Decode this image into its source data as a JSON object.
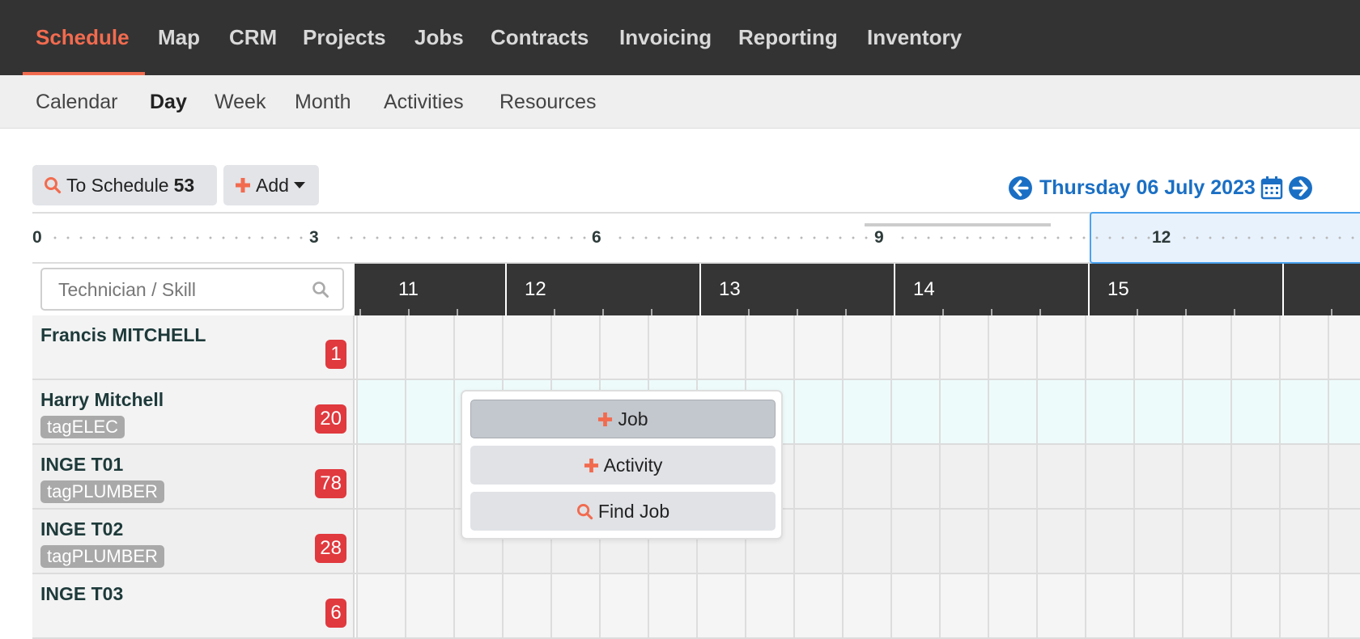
{
  "top_nav": {
    "items": [
      "Schedule",
      "Map",
      "CRM",
      "Projects",
      "Jobs",
      "Contracts",
      "Invoicing",
      "Reporting",
      "Inventory"
    ],
    "active": "Schedule",
    "accent_color": "#f26b4f"
  },
  "sub_nav": {
    "items": [
      "Calendar",
      "Day",
      "Week",
      "Month",
      "Activities",
      "Resources"
    ],
    "active": "Day"
  },
  "toolbar": {
    "to_schedule_label": "To Schedule",
    "to_schedule_count": "53",
    "add_label": "Add",
    "date": "Thursday 06 July 2023",
    "icons": [
      "search-icon",
      "plus-icon",
      "caret-down-icon",
      "arrow-left-circle-icon",
      "calendar-icon",
      "arrow-right-circle-icon"
    ]
  },
  "overview_ruler": {
    "ticks": [
      "0",
      "3",
      "6",
      "9",
      "12"
    ]
  },
  "resource_search": {
    "placeholder": "Technician / Skill"
  },
  "timeline": {
    "hours": [
      "11",
      "12",
      "13",
      "14",
      "15"
    ]
  },
  "resources": [
    {
      "name": "Francis MITCHELL",
      "tag": "",
      "count": "1"
    },
    {
      "name": "Harry Mitchell",
      "tag": "tagELEC",
      "count": "20"
    },
    {
      "name": "INGE T01",
      "tag": "tagPLUMBER",
      "count": "78"
    },
    {
      "name": "INGE T02",
      "tag": "tagPLUMBER",
      "count": "28"
    },
    {
      "name": "INGE T03",
      "tag": "",
      "count": "6"
    }
  ],
  "context_menu": {
    "job_label": "Job",
    "activity_label": "Activity",
    "find_job_label": "Find Job"
  },
  "colors": {
    "top_nav_bg": "#333333",
    "date_blue": "#1a6fc4",
    "count_badge_red": "#e0393e",
    "tag_gray": "#a9a9a9"
  }
}
